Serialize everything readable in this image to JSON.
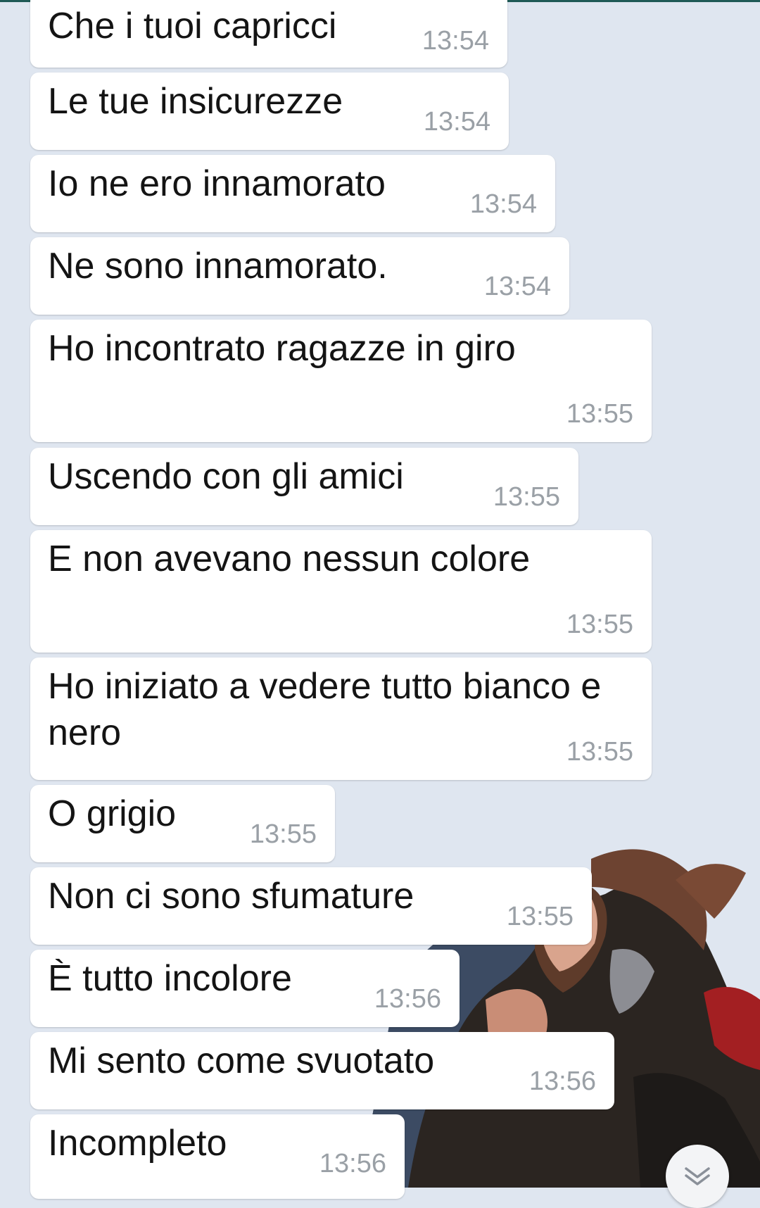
{
  "messages": [
    {
      "text": "Che i tuoi capricci",
      "time": "13:54"
    },
    {
      "text": "Le tue insicurezze",
      "time": "13:54"
    },
    {
      "text": "Io ne ero innamorato",
      "time": "13:54"
    },
    {
      "text": "Ne sono innamorato.",
      "time": "13:54"
    },
    {
      "text": "Ho incontrato ragazze in giro",
      "time": "13:55"
    },
    {
      "text": "Uscendo con gli amici",
      "time": "13:55"
    },
    {
      "text": "E non avevano nessun colore",
      "time": "13:55"
    },
    {
      "text": "Ho iniziato a vedere tutto bianco e nero",
      "time": "13:55"
    },
    {
      "text": "O grigio",
      "time": "13:55"
    },
    {
      "text": "Non ci sono sfumature",
      "time": "13:55"
    },
    {
      "text": "È tutto incolore",
      "time": "13:56"
    },
    {
      "text": "Mi sento come svuotato",
      "time": "13:56"
    },
    {
      "text": "Incompleto",
      "time": "13:56"
    }
  ],
  "scroll_down_icon": "double-chevron-down-icon"
}
